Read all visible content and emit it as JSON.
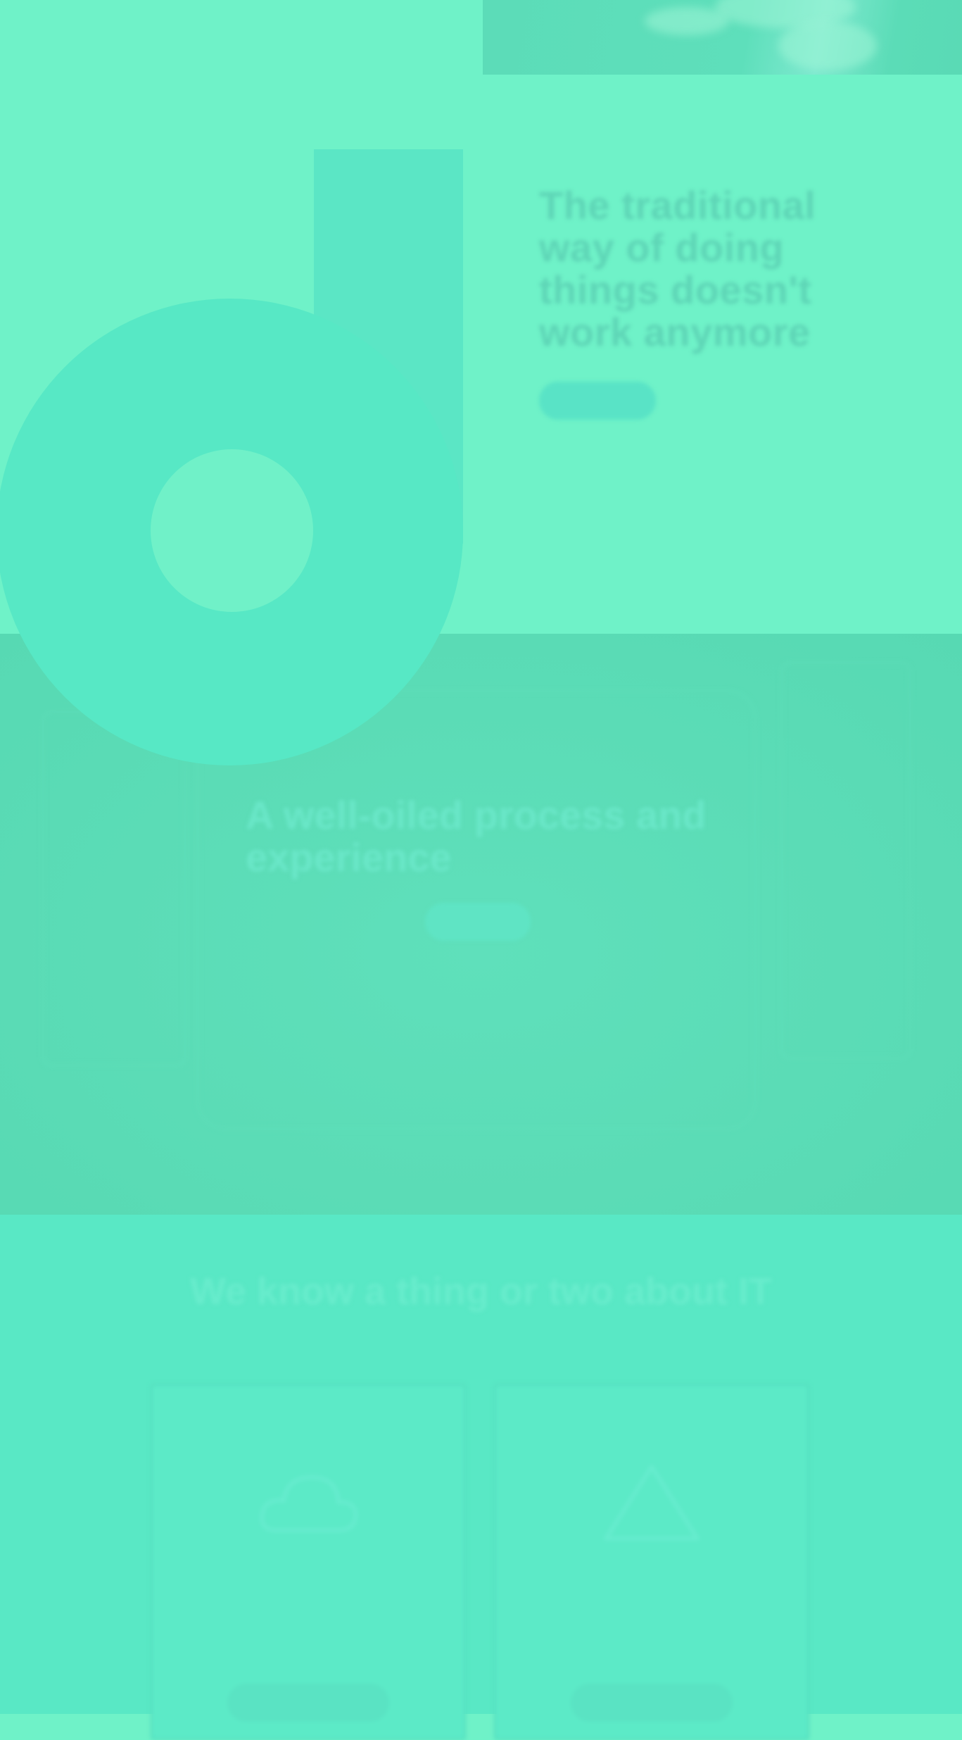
{
  "hero": {
    "title": "The traditional way of doing things doesn't work anymore",
    "body": "",
    "button_label": ""
  },
  "process": {
    "title": "A well-oiled process and experience",
    "body": "",
    "button_label": ""
  },
  "it": {
    "title": "We know a thing or two about IT",
    "cards": [
      {
        "icon": "cloud-icon",
        "text": "",
        "button_label": ""
      },
      {
        "icon": "warning-icon",
        "text": "",
        "button_label": ""
      }
    ]
  },
  "colors": {
    "background": "#6ff2c8",
    "logo": "#57e8c5",
    "title_text": "#5ed5b6",
    "section2": "#5bdcb6",
    "section3": "#59e8c5"
  }
}
